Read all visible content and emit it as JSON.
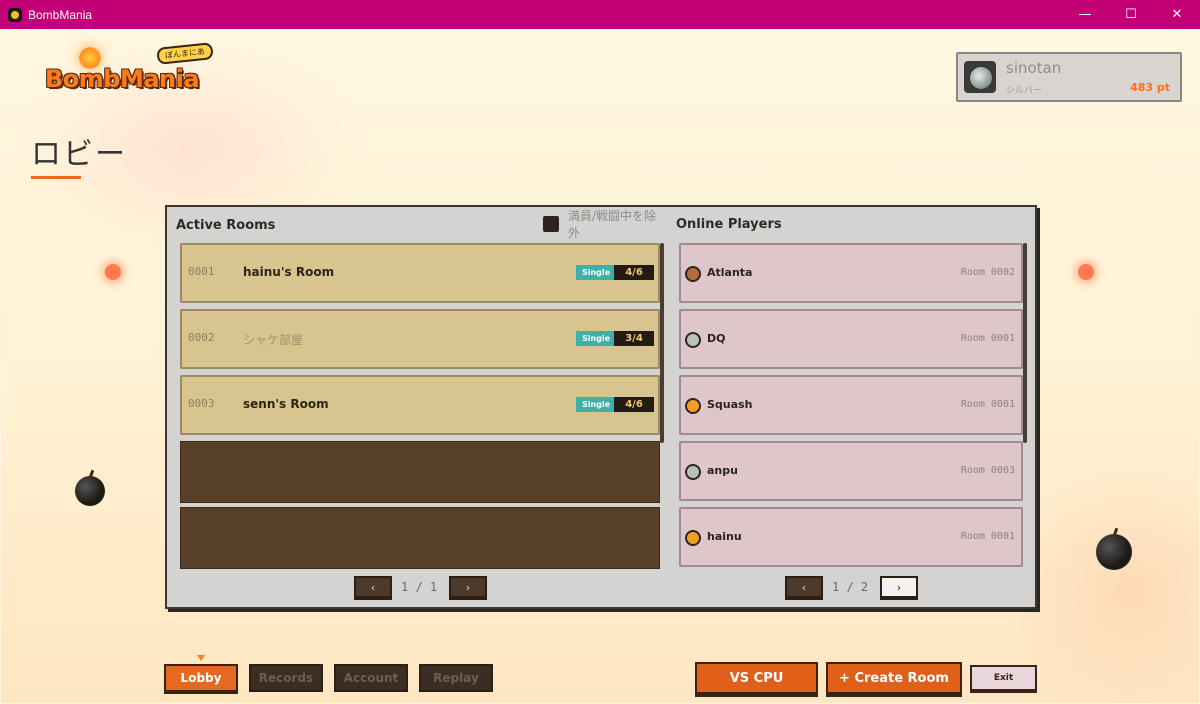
{
  "window": {
    "title": "BombMania",
    "minimize": "—",
    "maximize": "☐",
    "close": "✕"
  },
  "logo": {
    "word": "BombMania",
    "tag": "ぼんまにあ"
  },
  "player": {
    "name": "sinotan",
    "rank": "シルバー",
    "points": "483 pt"
  },
  "page": {
    "title": "ロビー"
  },
  "rooms_panel": {
    "heading": "Active Rooms",
    "exclude_label": "満員/戦闘中を除外",
    "rooms": [
      {
        "id": "0001",
        "name": "hainu's Room",
        "mode": "Single",
        "count": "4/6"
      },
      {
        "id": "0002",
        "name": "シャケ部屋",
        "mode": "Single",
        "count": "3/4"
      },
      {
        "id": "0003",
        "name": "senn's Room",
        "mode": "Single",
        "count": "4/6"
      }
    ],
    "pager": {
      "prev": "‹",
      "next": "›",
      "text": "1 / 1"
    }
  },
  "players_panel": {
    "heading": "Online Players",
    "players": [
      {
        "name": "Atlanta",
        "room": "Room 0002",
        "medal": "bronze"
      },
      {
        "name": "DQ",
        "room": "Room 0001",
        "medal": "silver"
      },
      {
        "name": "Squash",
        "room": "Room 0001",
        "medal": "gold"
      },
      {
        "name": "anpu",
        "room": "Room 0003",
        "medal": "silver"
      },
      {
        "name": "hainu",
        "room": "Room 0001",
        "medal": "gold"
      }
    ],
    "pager": {
      "prev": "‹",
      "next": "›",
      "text": "1 / 2"
    }
  },
  "nav": {
    "lobby": "Lobby",
    "records": "Records",
    "account": "Account",
    "replay": "Replay"
  },
  "actions": {
    "vs_cpu": "VS CPU",
    "create_room": "+ Create Room",
    "exit": "Exit"
  },
  "colors": {
    "title_bar": "#c40077",
    "accent": "#e56a1f",
    "mode_badge": "#3eb0a8",
    "room_row": "#d8c48f",
    "player_row": "#dfc6ca",
    "bronze": "#b86a3a",
    "silver": "#b9c0bd",
    "gold": "#f0a020"
  }
}
